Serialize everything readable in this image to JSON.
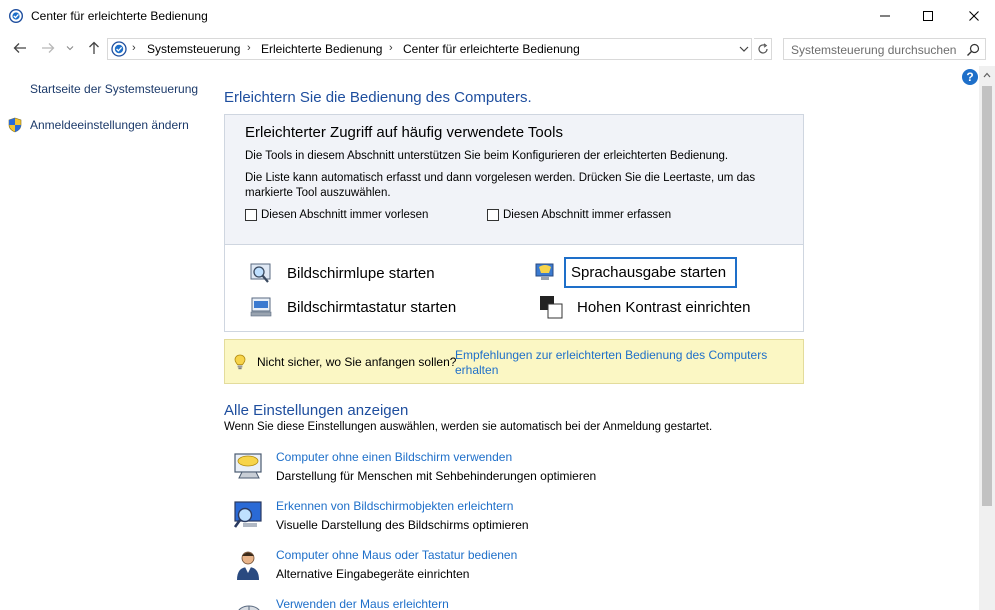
{
  "window": {
    "title": "Center für erleichterte Bedienung"
  },
  "address": {
    "crumbs": [
      "Systemsteuerung",
      "Erleichterte Bedienung",
      "Center für erleichterte Bedienung"
    ],
    "search_placeholder": "Systemsteuerung durchsuchen"
  },
  "left": {
    "home_link": "Startseite der Systemsteuerung",
    "logon_link": "Anmeldeeinstellungen ändern"
  },
  "main": {
    "heading": "Erleichtern Sie die Bedienung des Computers.",
    "tools": {
      "title": "Erleichterter Zugriff auf häufig verwendete Tools",
      "desc1": "Die Tools in diesem Abschnitt unterstützen Sie beim Konfigurieren der erleichterten Bedienung.",
      "desc2": "Die Liste kann automatisch erfasst und dann vorgelesen werden. Drücken Sie die Leertaste, um das markierte Tool auszuwählen.",
      "checkbox_read": "Diesen Abschnitt immer vorlesen",
      "checkbox_scan": "Diesen Abschnitt immer erfassen",
      "magnifier": "Bildschirmlupe starten",
      "narrator": "Sprachausgabe starten",
      "osk": "Bildschirmtastatur starten",
      "contrast": "Hohen Kontrast einrichten"
    },
    "tip": {
      "label": "Nicht sicher, wo Sie anfangen sollen?",
      "link": "Empfehlungen zur erleichterten Bedienung des Computers erhalten"
    },
    "all_heading": "Alle Einstellungen anzeigen",
    "all_desc": "Wenn Sie diese Einstellungen auswählen, werden sie automatisch bei der Anmeldung gestartet.",
    "settings": [
      {
        "link": "Computer ohne einen Bildschirm verwenden",
        "desc": "Darstellung für Menschen mit Sehbehinderungen optimieren"
      },
      {
        "link": "Erkennen von Bildschirmobjekten erleichtern",
        "desc": "Visuelle Darstellung des Bildschirms optimieren"
      },
      {
        "link": "Computer ohne Maus oder Tastatur bedienen",
        "desc": "Alternative Eingabegeräte einrichten"
      },
      {
        "link": "Verwenden der Maus erleichtern",
        "desc": ""
      }
    ]
  }
}
